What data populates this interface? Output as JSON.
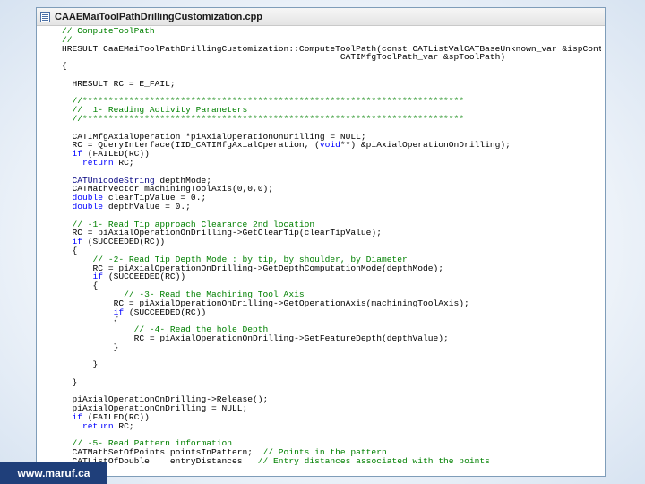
{
  "window": {
    "file_icon": "document-icon",
    "title": "CAAEMaiToolPathDrillingCustomization.cpp"
  },
  "code_lines": [
    [
      {
        "t": "c",
        "v": "// ComputeToolPath"
      }
    ],
    [
      {
        "t": "c",
        "v": "//"
      }
    ],
    [
      {
        "t": "p",
        "v": "HRESULT CaaEMaiToolPathDrillingCustomization::ComputeToolPath(const CATListValCATBaseUnknown_var &ispContainer,"
      }
    ],
    [
      {
        "t": "p",
        "v": "                                                      CATIMfgToolPath_var &spToolPath)"
      }
    ],
    [
      {
        "t": "p",
        "v": "{"
      }
    ],
    [
      {
        "t": "p",
        "v": ""
      }
    ],
    [
      {
        "t": "p",
        "v": "  HRESULT RC = E_FAIL;"
      }
    ],
    [
      {
        "t": "p",
        "v": ""
      }
    ],
    [
      {
        "t": "c",
        "v": "  //**************************************************************************"
      }
    ],
    [
      {
        "t": "c",
        "v": "  //  1- Reading Activity Parameters"
      }
    ],
    [
      {
        "t": "c",
        "v": "  //**************************************************************************"
      }
    ],
    [
      {
        "t": "p",
        "v": ""
      }
    ],
    [
      {
        "t": "p",
        "v": "  CATIMfgAxialOperation *piAxialOperationOnDrilling = NULL;"
      }
    ],
    [
      {
        "t": "p",
        "v": "  RC = QueryInterface(IID_CATIMfgAxialOperation, ("
      },
      {
        "t": "k",
        "v": "void"
      },
      {
        "t": "p",
        "v": "**) &piAxialOperationOnDrilling);"
      }
    ],
    [
      {
        "t": "k",
        "v": "  if"
      },
      {
        "t": "p",
        "v": " (FAILED(RC))"
      }
    ],
    [
      {
        "t": "k",
        "v": "    return"
      },
      {
        "t": "p",
        "v": " RC;"
      }
    ],
    [
      {
        "t": "p",
        "v": ""
      }
    ],
    [
      {
        "t": "y",
        "v": "  CATUnicodeString"
      },
      {
        "t": "p",
        "v": " depthMode;"
      }
    ],
    [
      {
        "t": "p",
        "v": "  CATMathVector machiningToolAxis(0,0,0);"
      }
    ],
    [
      {
        "t": "k",
        "v": "  double"
      },
      {
        "t": "p",
        "v": " clearTipValue = 0.;"
      }
    ],
    [
      {
        "t": "k",
        "v": "  double"
      },
      {
        "t": "p",
        "v": " depthValue = 0.;"
      }
    ],
    [
      {
        "t": "p",
        "v": ""
      }
    ],
    [
      {
        "t": "c",
        "v": "  // -1- Read Tip approach Clearance 2nd location"
      }
    ],
    [
      {
        "t": "p",
        "v": "  RC = piAxialOperationOnDrilling->GetClearTip(clearTipValue);"
      }
    ],
    [
      {
        "t": "k",
        "v": "  if"
      },
      {
        "t": "p",
        "v": " (SUCCEEDED(RC))"
      }
    ],
    [
      {
        "t": "p",
        "v": "  {"
      }
    ],
    [
      {
        "t": "c",
        "v": "      // -2- Read Tip Depth Mode : by tip, by shoulder, by Diameter"
      }
    ],
    [
      {
        "t": "p",
        "v": "      RC = piAxialOperationOnDrilling->GetDepthComputationMode(depthMode);"
      }
    ],
    [
      {
        "t": "k",
        "v": "      if"
      },
      {
        "t": "p",
        "v": " (SUCCEEDED(RC))"
      }
    ],
    [
      {
        "t": "p",
        "v": "      {"
      }
    ],
    [
      {
        "t": "c",
        "v": "            // -3- Read the Machining Tool Axis"
      }
    ],
    [
      {
        "t": "p",
        "v": "          RC = piAxialOperationOnDrilling->GetOperationAxis(machiningToolAxis);"
      }
    ],
    [
      {
        "t": "k",
        "v": "          if"
      },
      {
        "t": "p",
        "v": " (SUCCEEDED(RC))"
      }
    ],
    [
      {
        "t": "p",
        "v": "          {"
      }
    ],
    [
      {
        "t": "c",
        "v": "              // -4- Read the hole Depth"
      }
    ],
    [
      {
        "t": "p",
        "v": "              RC = piAxialOperationOnDrilling->GetFeatureDepth(depthValue);"
      }
    ],
    [
      {
        "t": "p",
        "v": "          }"
      }
    ],
    [
      {
        "t": "p",
        "v": ""
      }
    ],
    [
      {
        "t": "p",
        "v": "      }"
      }
    ],
    [
      {
        "t": "p",
        "v": ""
      }
    ],
    [
      {
        "t": "p",
        "v": "  }"
      }
    ],
    [
      {
        "t": "p",
        "v": ""
      }
    ],
    [
      {
        "t": "p",
        "v": "  piAxialOperationOnDrilling->Release();"
      }
    ],
    [
      {
        "t": "p",
        "v": "  piAxialOperationOnDrilling = NULL;"
      }
    ],
    [
      {
        "t": "k",
        "v": "  if"
      },
      {
        "t": "p",
        "v": " (FAILED(RC))"
      }
    ],
    [
      {
        "t": "k",
        "v": "    return"
      },
      {
        "t": "p",
        "v": " RC;"
      }
    ],
    [
      {
        "t": "p",
        "v": ""
      }
    ],
    [
      {
        "t": "c",
        "v": "  // -5- Read Pattern information"
      }
    ],
    [
      {
        "t": "p",
        "v": "  CATMathSetOfPoints pointsInPattern;  "
      },
      {
        "t": "c",
        "v": "// Points in the pattern"
      }
    ],
    [
      {
        "t": "p",
        "v": "  CATListOfDouble    entryDistances   "
      },
      {
        "t": "c",
        "v": "// Entry distances associated with the points"
      }
    ]
  ],
  "badge": {
    "text": "www.maruf.ca"
  }
}
